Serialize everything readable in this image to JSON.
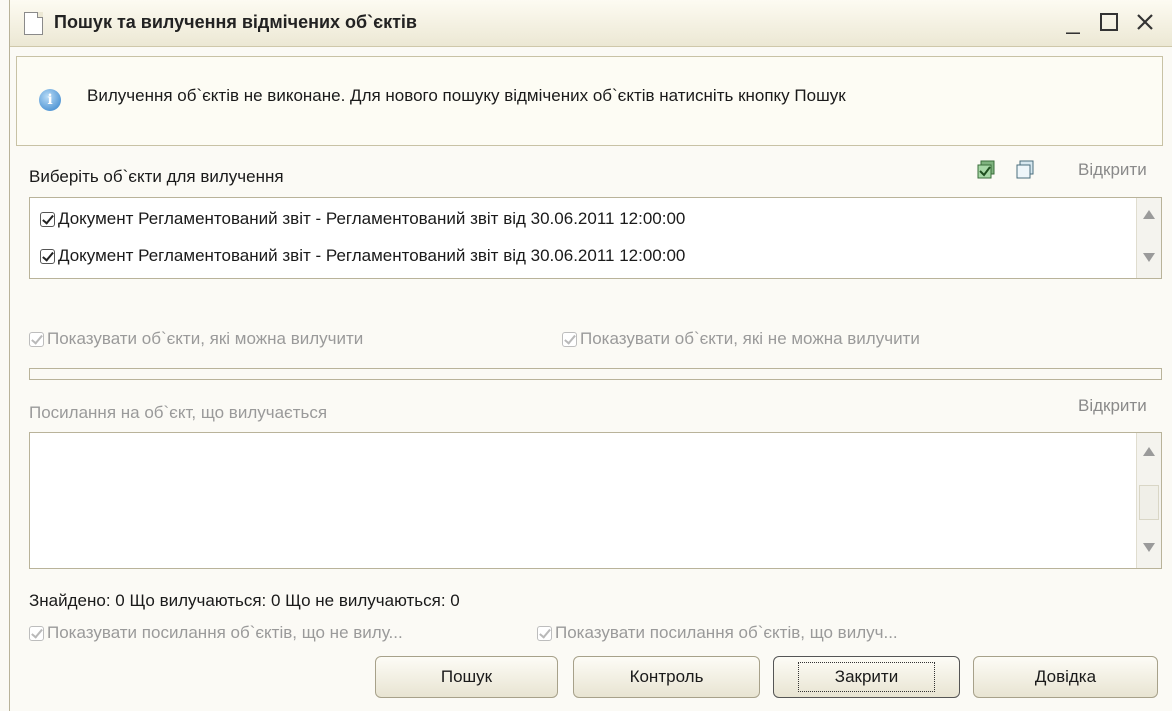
{
  "window": {
    "title": "Пошук та вилучення відмічених об`єктів"
  },
  "info": {
    "message": "Вилучення об`єктів не виконане. Для нового пошуку відмічених об`єктів натисніть кнопку Пошук"
  },
  "objects_section": {
    "label": "Виберіть об`єкти для вилучення",
    "open_link": "Відкрити",
    "items": [
      {
        "label": "Документ Регламентований звіт - Регламентований звіт від 30.06.2011 12:00:00",
        "checked": true
      },
      {
        "label": "Документ Регламентований звіт - Регламентований звіт від 30.06.2011 12:00:00",
        "checked": true
      }
    ]
  },
  "filters": {
    "show_deletable": "Показувати об`єкти, які можна вилучити",
    "show_not_deletable": "Показувати об`єкти, які не можна вилучити"
  },
  "references_section": {
    "label": "Посилання на об`єкт, що вилучається",
    "open_link": "Відкрити"
  },
  "stats": {
    "text": "Знайдено: 0  Що вилучаються: 0  Що не вилучаються: 0"
  },
  "ref_filters": {
    "show_not_deleted_refs": "Показувати посилання об`єктів, що не вилу...",
    "show_deleted_refs": "Показувати посилання об`єктів, що вилуч..."
  },
  "buttons": {
    "search": "Пошук",
    "control": "Контроль",
    "close": "Закрити",
    "help": "Довідка"
  },
  "icons": {
    "document": "document-icon",
    "info": "info-icon",
    "check_all": "check-all-icon",
    "uncheck_all": "uncheck-all-icon"
  },
  "colors": {
    "accent": "#2f7fc9",
    "titlebar": "#ece8d4",
    "disabled_text": "#9a9a9a"
  }
}
